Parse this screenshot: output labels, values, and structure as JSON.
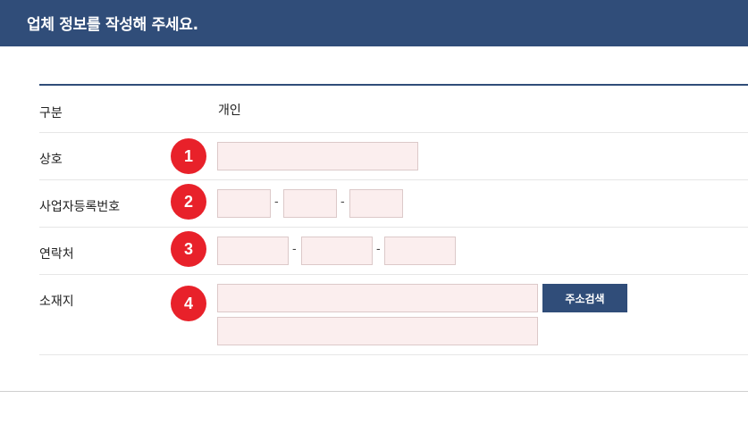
{
  "header": {
    "title": "업체 정보를 작성해 주세요."
  },
  "form": {
    "type": {
      "label": "구분",
      "value": "개인"
    },
    "company_name": {
      "label": "상호",
      "badge": "1",
      "value": "",
      "placeholder": ""
    },
    "business_number": {
      "label": "사업자등록번호",
      "badge": "2",
      "parts": [
        "",
        "",
        ""
      ],
      "separator": "-"
    },
    "contact": {
      "label": "연락처",
      "badge": "3",
      "parts": [
        "",
        "",
        ""
      ],
      "separator": "-"
    },
    "address": {
      "label": "소재지",
      "badge": "4",
      "line1": "",
      "line2": "",
      "search_button": "주소검색"
    }
  },
  "colors": {
    "header_bg": "#304d79",
    "badge_red": "#e8212a",
    "field_bg": "#fbeeee",
    "button_bg": "#304d79"
  }
}
